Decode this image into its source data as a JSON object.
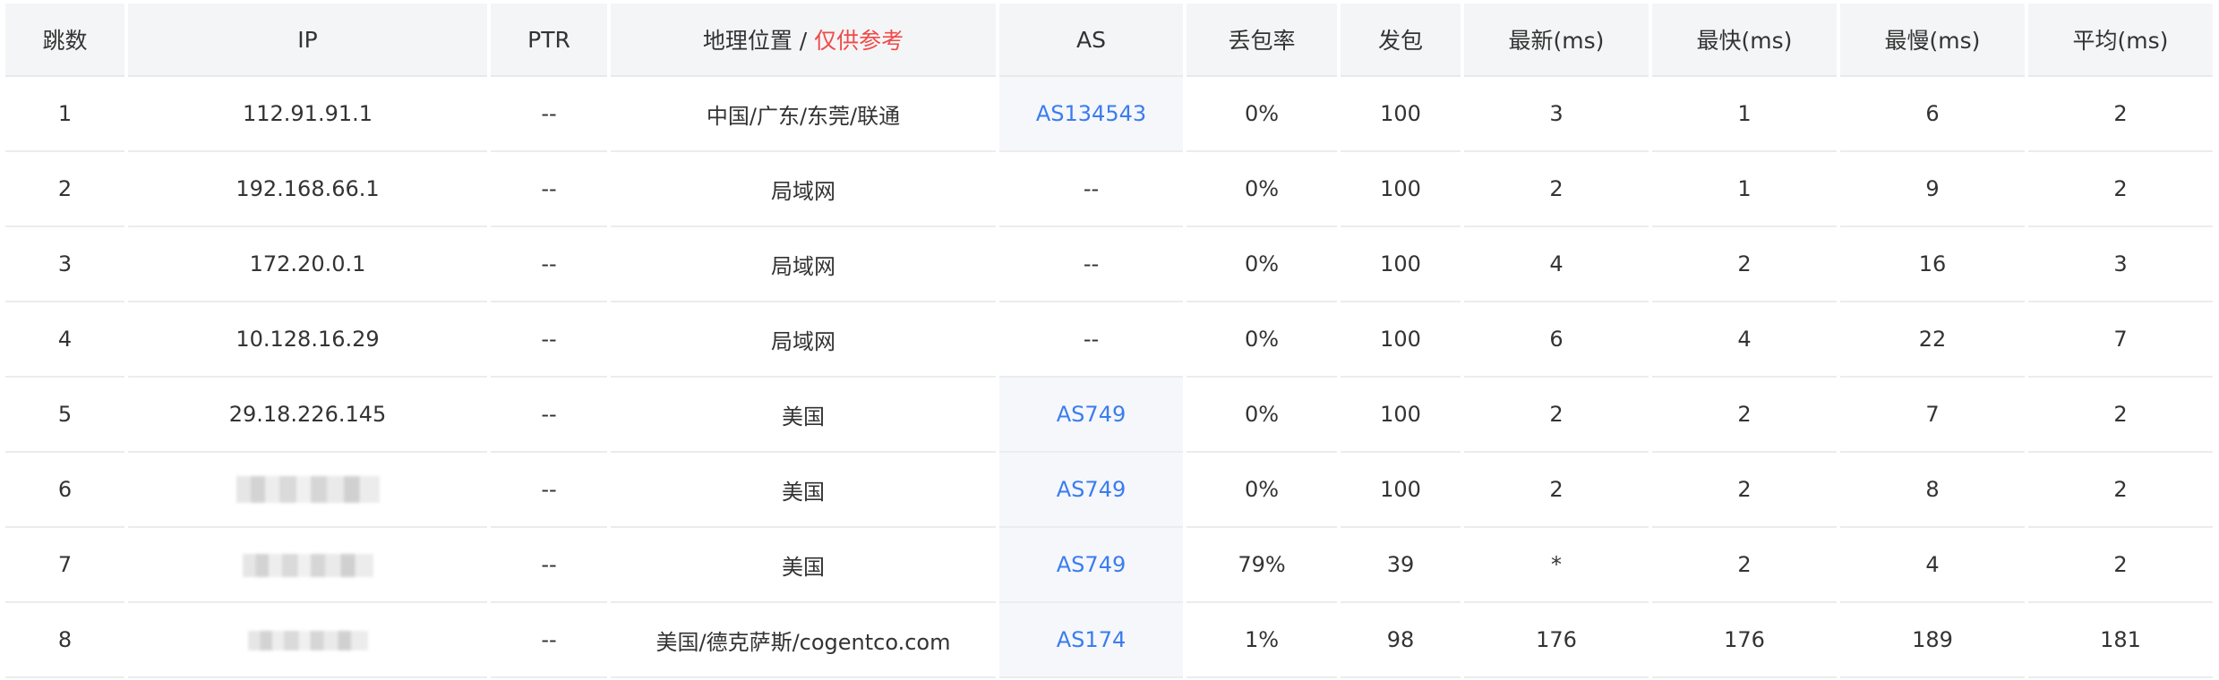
{
  "table": {
    "headers": {
      "hop": "跳数",
      "ip": "IP",
      "ptr": "PTR",
      "geo_main": "地理位置",
      "geo_sep": " / ",
      "geo_note": "仅供参考",
      "as": "AS",
      "loss": "丢包率",
      "sent": "发包",
      "last": "最新(ms)",
      "best": "最快(ms)",
      "worst": "最慢(ms)",
      "avg": "平均(ms)"
    },
    "rows": [
      {
        "hop": "1",
        "ip": "112.91.91.1",
        "ptr": "--",
        "geo": "中国/广东/东莞/联通",
        "as": "AS134543",
        "loss": "0%",
        "sent": "100",
        "last": "3",
        "best": "1",
        "worst": "6",
        "avg": "2"
      },
      {
        "hop": "2",
        "ip": "192.168.66.1",
        "ptr": "--",
        "geo": "局域网",
        "as": "--",
        "loss": "0%",
        "sent": "100",
        "last": "2",
        "best": "1",
        "worst": "9",
        "avg": "2"
      },
      {
        "hop": "3",
        "ip": "172.20.0.1",
        "ptr": "--",
        "geo": "局域网",
        "as": "--",
        "loss": "0%",
        "sent": "100",
        "last": "4",
        "best": "2",
        "worst": "16",
        "avg": "3"
      },
      {
        "hop": "4",
        "ip": "10.128.16.29",
        "ptr": "--",
        "geo": "局域网",
        "as": "--",
        "loss": "0%",
        "sent": "100",
        "last": "6",
        "best": "4",
        "worst": "22",
        "avg": "7"
      },
      {
        "hop": "5",
        "ip": "29.18.226.145",
        "ptr": "--",
        "geo": "美国",
        "as": "AS749",
        "loss": "0%",
        "sent": "100",
        "last": "2",
        "best": "2",
        "worst": "7",
        "avg": "2"
      },
      {
        "hop": "6",
        "ip": "",
        "ptr": "--",
        "geo": "美国",
        "as": "AS749",
        "loss": "0%",
        "sent": "100",
        "last": "2",
        "best": "2",
        "worst": "8",
        "avg": "2"
      },
      {
        "hop": "7",
        "ip": "",
        "ptr": "--",
        "geo": "美国",
        "as": "AS749",
        "loss": "79%",
        "sent": "39",
        "last": "*",
        "best": "2",
        "worst": "4",
        "avg": "2"
      },
      {
        "hop": "8",
        "ip": "",
        "ptr": "--",
        "geo": "美国/德克萨斯/cogentco.com",
        "as": "AS174",
        "loss": "1%",
        "sent": "98",
        "last": "176",
        "best": "176",
        "worst": "189",
        "avg": "181"
      }
    ]
  },
  "colors": {
    "header_bg": "#f4f5f6",
    "link": "#3a7cf0",
    "note": "#f04a4a",
    "text": "#333333"
  }
}
